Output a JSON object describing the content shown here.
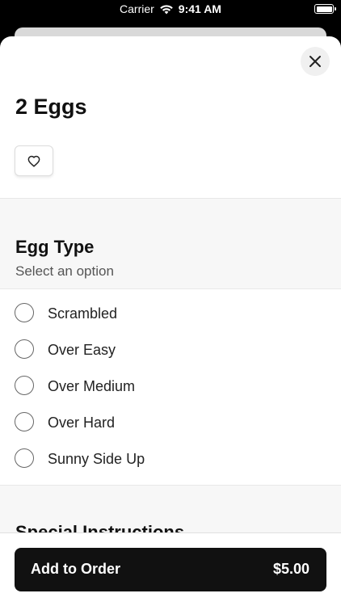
{
  "status_bar": {
    "carrier": "Carrier",
    "time": "9:41 AM"
  },
  "item": {
    "title": "2 Eggs"
  },
  "egg_type": {
    "title": "Egg Type",
    "subtitle": "Select an option",
    "options": [
      {
        "label": "Scrambled"
      },
      {
        "label": "Over Easy"
      },
      {
        "label": "Over Medium"
      },
      {
        "label": "Over Hard"
      },
      {
        "label": "Sunny Side Up"
      }
    ]
  },
  "special_instructions": {
    "title": "Special Instructions"
  },
  "footer": {
    "add_label": "Add to Order",
    "price": "$5.00"
  },
  "icons": {
    "close": "close-icon",
    "favorite": "heart-icon",
    "wifi": "wifi-icon",
    "battery": "battery-icon"
  },
  "colors": {
    "button_bg": "#111111",
    "section_bg": "#f7f7f7"
  }
}
